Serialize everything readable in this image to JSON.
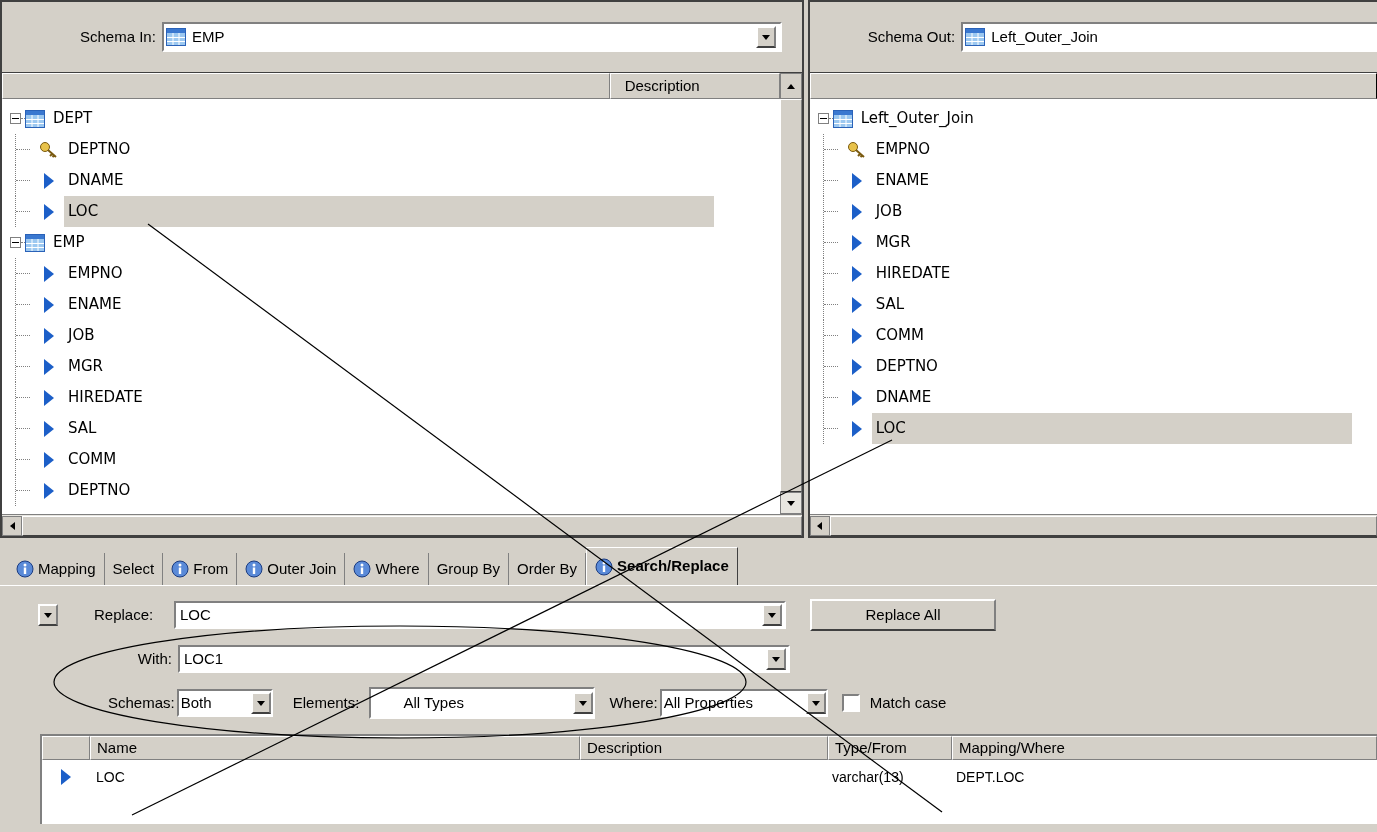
{
  "schema_in": {
    "label": "Schema In:",
    "value": "EMP"
  },
  "input_tree": {
    "column": "Description",
    "items": [
      {
        "name": "DEPT",
        "kind": "table",
        "expanded": true,
        "selected": false,
        "children": [
          {
            "name": "DEPTNO",
            "kind": "key",
            "selected": false
          },
          {
            "name": "DNAME",
            "kind": "column",
            "selected": false
          },
          {
            "name": "LOC",
            "kind": "column",
            "selected": true
          }
        ]
      },
      {
        "name": "EMP",
        "kind": "table",
        "expanded": true,
        "selected": false,
        "children": [
          {
            "name": "EMPNO",
            "kind": "column",
            "selected": false
          },
          {
            "name": "ENAME",
            "kind": "column",
            "selected": false
          },
          {
            "name": "JOB",
            "kind": "column",
            "selected": false
          },
          {
            "name": "MGR",
            "kind": "column",
            "selected": false
          },
          {
            "name": "HIREDATE",
            "kind": "column",
            "selected": false
          },
          {
            "name": "SAL",
            "kind": "column",
            "selected": false
          },
          {
            "name": "COMM",
            "kind": "column",
            "selected": false
          },
          {
            "name": "DEPTNO",
            "kind": "column",
            "selected": false
          }
        ]
      }
    ]
  },
  "schema_out": {
    "label": "Schema Out:",
    "value": "Left_Outer_Join"
  },
  "output_tree": {
    "items": [
      {
        "name": "Left_Outer_Join",
        "kind": "table",
        "expanded": true,
        "selected": false,
        "children": [
          {
            "name": "EMPNO",
            "kind": "key",
            "selected": false
          },
          {
            "name": "ENAME",
            "kind": "column",
            "selected": false
          },
          {
            "name": "JOB",
            "kind": "column",
            "selected": false
          },
          {
            "name": "MGR",
            "kind": "column",
            "selected": false
          },
          {
            "name": "HIREDATE",
            "kind": "column",
            "selected": false
          },
          {
            "name": "SAL",
            "kind": "column",
            "selected": false
          },
          {
            "name": "COMM",
            "kind": "column",
            "selected": false
          },
          {
            "name": "DEPTNO",
            "kind": "column",
            "selected": false
          },
          {
            "name": "DNAME",
            "kind": "column",
            "selected": false
          },
          {
            "name": "LOC",
            "kind": "column",
            "selected": true
          }
        ]
      }
    ]
  },
  "tabs": [
    {
      "label": "Mapping",
      "info": true,
      "selected": false
    },
    {
      "label": "Select",
      "info": false,
      "selected": false
    },
    {
      "label": "From",
      "info": true,
      "selected": false
    },
    {
      "label": "Outer Join",
      "info": true,
      "selected": false
    },
    {
      "label": "Where",
      "info": true,
      "selected": false
    },
    {
      "label": "Group By",
      "info": false,
      "selected": false
    },
    {
      "label": "Order By",
      "info": false,
      "selected": false
    },
    {
      "label": "Search/Replace",
      "info": true,
      "selected": true
    }
  ],
  "search": {
    "replace_label": "Replace:",
    "replace_value": "LOC",
    "with_label": "With:",
    "with_value": "LOC1",
    "replace_all": "Replace All",
    "schemas_label": "Schemas:",
    "schemas_value": "Both",
    "elements_label": "Elements:",
    "elements_value": "All Types",
    "where_label": "Where:",
    "where_value": "All Properties",
    "match_case_label": "Match case",
    "match_case": false
  },
  "results": {
    "columns": [
      "Name",
      "Description",
      "Type/From",
      "Mapping/Where"
    ],
    "rows": [
      {
        "name": "LOC",
        "type_from": "varchar(13)",
        "mapping_where": "DEPT.LOC"
      }
    ]
  }
}
